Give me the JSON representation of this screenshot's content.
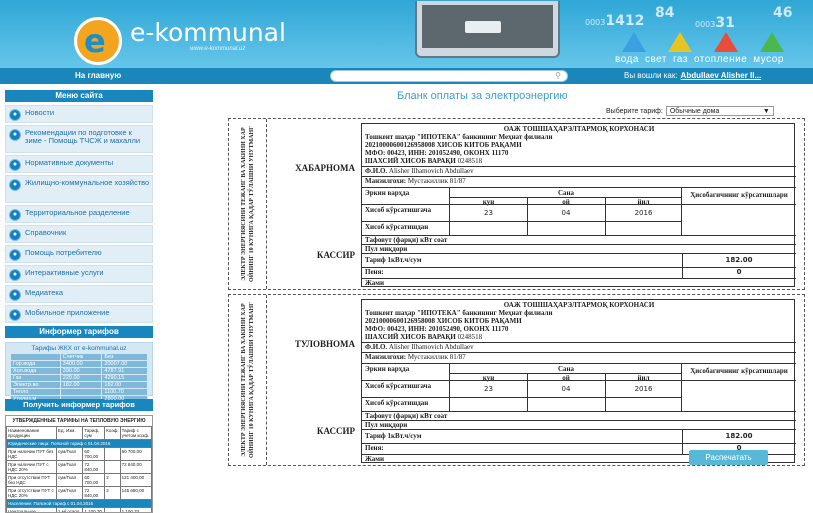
{
  "header": {
    "logo_glyph": "e",
    "logo_text": "e-kommunal",
    "logo_sub": "www.e-kommunal.uz",
    "digits": [
      {
        "big": "84",
        "small": "0003"
      },
      {
        "big": "46",
        "small": "0003"
      },
      {
        "big": "1412",
        "small": ""
      },
      {
        "big": "31",
        "small": "7"
      }
    ],
    "utilities": [
      "вода",
      "свет",
      "газ",
      "отопление",
      "мусор"
    ]
  },
  "nav": {
    "home": "На главную",
    "search_placeholder": "",
    "login_prefix": "Вы вошли как:",
    "login_user": "Abdullaev Alisher Il..."
  },
  "sidebar": {
    "menu_title": "Меню сайта",
    "items": [
      {
        "label": "Новости",
        "icon": "news-icon"
      },
      {
        "label": "Рекомендации по подготовке к зиме - Помощь ТЧСЖ и махалли",
        "icon": "house-icon"
      },
      {
        "label": "Нормативные документы",
        "icon": "document-icon"
      },
      {
        "label": "Жилищно-коммунальное хозяйство",
        "icon": "wrench-icon"
      },
      {
        "label": "Территориальное разделение",
        "icon": "map-icon"
      },
      {
        "label": "Справочник",
        "icon": "book-icon"
      },
      {
        "label": "Помощь потребителю",
        "icon": "help-icon"
      },
      {
        "label": "Интерактивные услуги",
        "icon": "service-icon"
      },
      {
        "label": "Медиатека",
        "icon": "media-icon"
      },
      {
        "label": "Мобильное приложение",
        "icon": "phone-icon"
      }
    ],
    "informer_title": "Информер тарифов",
    "informer_sub": "Тарифы ЖКХ от e-kommunal.uz",
    "informer_head": [
      "",
      "Счетчик",
      "Без"
    ],
    "informer_rows": [
      [
        "Гор.вода",
        "3400.00",
        "20007.00"
      ],
      [
        "Хол.вода",
        "390.00",
        "4787.91"
      ],
      [
        "Газ",
        "220.00",
        "4290.15"
      ],
      [
        "Электр.во",
        "182.00",
        "182.00"
      ],
      [
        "Тепло",
        "",
        "1100.70"
      ],
      [
        "Утилиз.м",
        "",
        "2800.00"
      ]
    ],
    "informer_btn": "Получить информер тарифов",
    "tariffs_title": "УТВЕРЖДЕННЫЕ ТАРИФЫ НА ТЕПЛОВУЮ ЭНЕРГИЮ",
    "tariffs_head": [
      "Наименование продукции",
      "Ед. Изм.",
      "Тариф, сум",
      "Коэф.",
      "Тариф с учетом коэф."
    ],
    "tariffs_rows": [
      [
        "Юридические лица: Поясной тариф с 01.04.2016",
        "",
        "",
        "",
        ""
      ],
      [
        "При наличии ПУТ без НДС",
        "сум/Гкал",
        "60 700,00",
        "",
        "60 700,00"
      ],
      [
        "При наличии ПУТ с НДС 20%",
        "сум/Гкал",
        "72 840,00",
        "",
        "72 840,00"
      ],
      [
        "При отсутствии ПУТ без НДС",
        "сум/Гкал",
        "60 700,00",
        "2",
        "121 400,00"
      ],
      [
        "При отсутствии ПУТ с НДС 20%",
        "сум/Гкал",
        "72 840,00",
        "2",
        "145 680,00"
      ],
      [
        "Население: Поясной тариф с 01.04.2016",
        "",
        "",
        "",
        ""
      ],
      [
        "Центральное отопление",
        "1 м² отапл. площ.",
        "1 100,70",
        "",
        "1 100,70"
      ],
      [
        "ГВС при отсутствии",
        "1чел.",
        "13 511,73",
        "1,5",
        "20 267,60"
      ]
    ]
  },
  "main": {
    "title": "Бланк оплаты за электроэнергию",
    "tariff_label": "Выберите тариф:",
    "tariff_value": "Обычные дома",
    "print_btn": "Распечатать"
  },
  "blanks": [
    {
      "vertical": "ЭЛЕКТР ЭНЕРГИЯСИНИ ТЕЖАНГ ВА ХАКИНИ ХАР ОЙНИНГ 10 КУНИГА ҚАДАР ТЎЛАШНИ УНУТМАНГ",
      "side": "ХАБАРНОМА",
      "cashier": "КАССИР"
    },
    {
      "vertical": "ЭЛЕКТР ЭНЕРГИЯСИНИ ТЕЖАНГ ВА ХАКИНИ ХАР ОЙНИНГ 10 КУНИГА ҚАДАР ТЎЛАШНИ УНУТМАНГ",
      "side": "ТУЛОВНОМА",
      "cashier": "КАССИР"
    }
  ],
  "form": {
    "org": "ОАЖ ТОШШАҲАРЭЛТАРМОҚ КОРХОНАСИ",
    "bank": "Тошкент шаҳар \"ИПОТЕКА\" банкининг Меҳнат филиали",
    "account": "20210000600126958008 ХИСОБ КИТОБ РАҚАМИ",
    "mfo": "МФО: 00423, ИНН: 201052490, ОКОНХ 11170",
    "personal_label": "ШАХСИЙ ХИСОБ ВАРАҚИ",
    "personal": "0248518",
    "fio_label": "Ф.И.О.",
    "fio": "Alisher Ilhamovich Abdullaev",
    "addr_label": "Манзилгохи:",
    "addr": "Мустакиллик 81/87",
    "date_hdr": "Сана",
    "meter_hdr": "Ҳисобагичнинг кўрсатишлари",
    "day": "кун",
    "month": "ой",
    "year": "йил",
    "readings_label": "Эркин варҳда",
    "r1": "Хисоб кўрсатишгача",
    "r2": "Хисоб кўрсатишдан",
    "d": "23",
    "m": "04",
    "y": "2016",
    "consumption": "Тафовут (фарқи) кВт соат",
    "sum": "Пул миқдори",
    "tariff": "Тариф 1кВт.ч/сум",
    "tariff_val": "182.00",
    "penalty": "Пеня:",
    "penalty_val": "0",
    "total": "Жами"
  }
}
